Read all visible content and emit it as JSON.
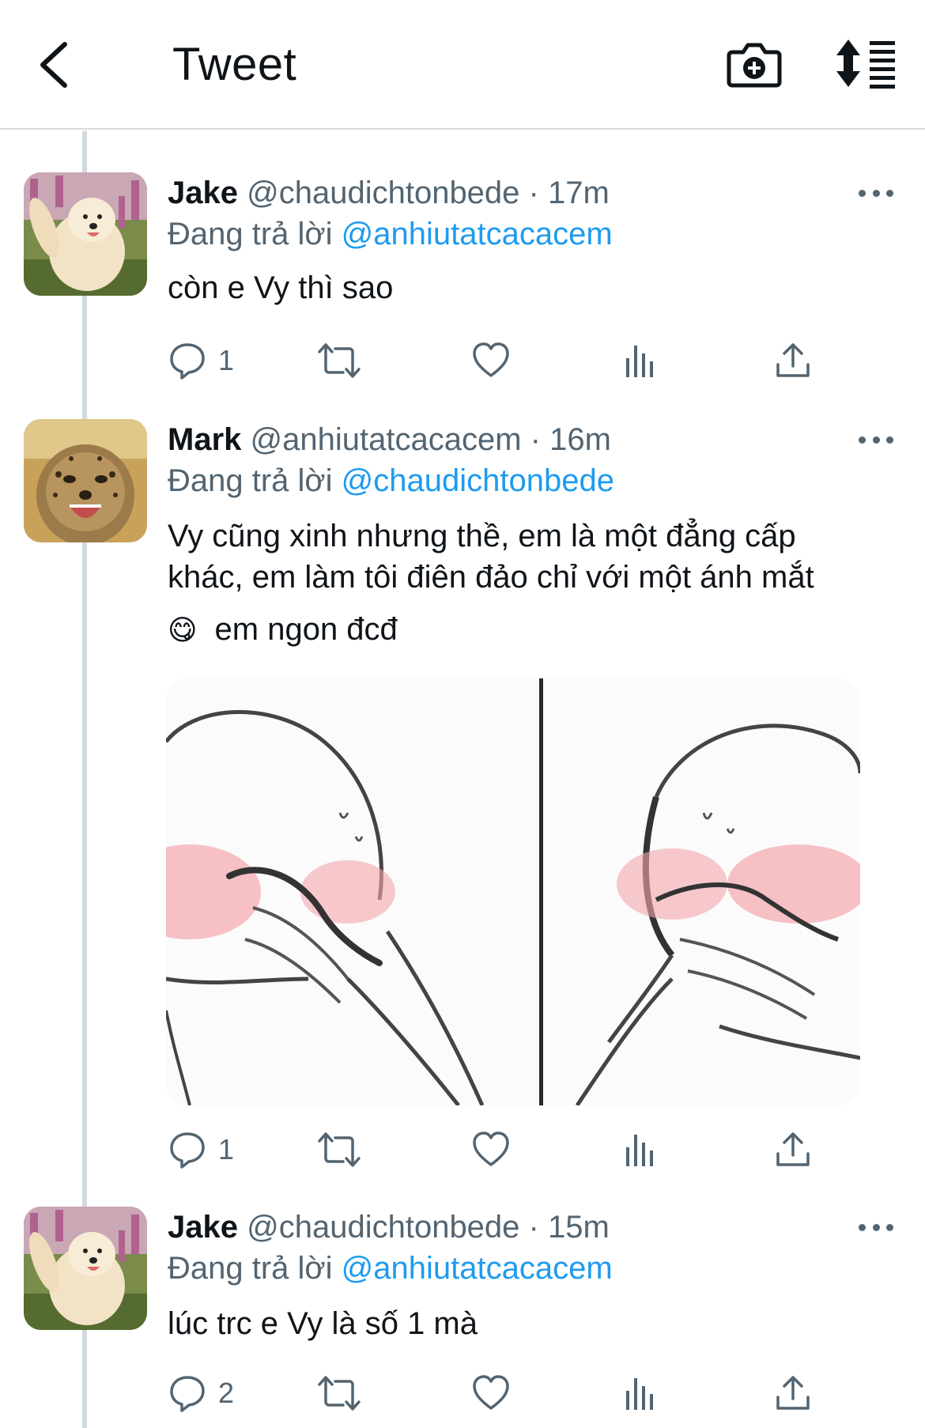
{
  "header": {
    "title": "Tweet",
    "back_icon": "chevron-left-icon",
    "camera_icon": "camera-plus-icon",
    "sort_icon": "sort-list-icon"
  },
  "colors": {
    "accent": "#1d9bf0",
    "text_primary": "#0f1419",
    "text_secondary": "#536471",
    "thread_line": "#cfd9de"
  },
  "tweets": [
    {
      "name": "Jake",
      "handle": "@chaudichtonbede",
      "time": "· 17m",
      "reply_prefix": "Đang trả lời",
      "reply_to": "@anhiutatcacacem",
      "text": "còn e Vy thì sao",
      "reply_count": "1",
      "avatar": "samoyed-dog-avatar"
    },
    {
      "name": "Mark",
      "handle": "@anhiutatcacacem",
      "time": "· 16m",
      "reply_prefix": "Đang trả lời",
      "reply_to": "@chaudichtonbede",
      "text_line1": "Vy cũng xinh nhưng thề, em là một đẳng cấp",
      "text_line2": "khác, em làm tôi điên đảo chỉ với một ánh mắt",
      "text_line3": "em ngon đcđ",
      "emoji": "😋",
      "reply_count": "1",
      "avatar": "cheetah-cub-avatar",
      "media": "blushing-cartoon-meme-image"
    },
    {
      "name": "Jake",
      "handle": "@chaudichtonbede",
      "time": "· 15m",
      "reply_prefix": "Đang trả lời",
      "reply_to": "@anhiutatcacacem",
      "text": "lúc trc e Vy là số 1 mà",
      "reply_count": "2",
      "avatar": "samoyed-dog-avatar"
    }
  ]
}
